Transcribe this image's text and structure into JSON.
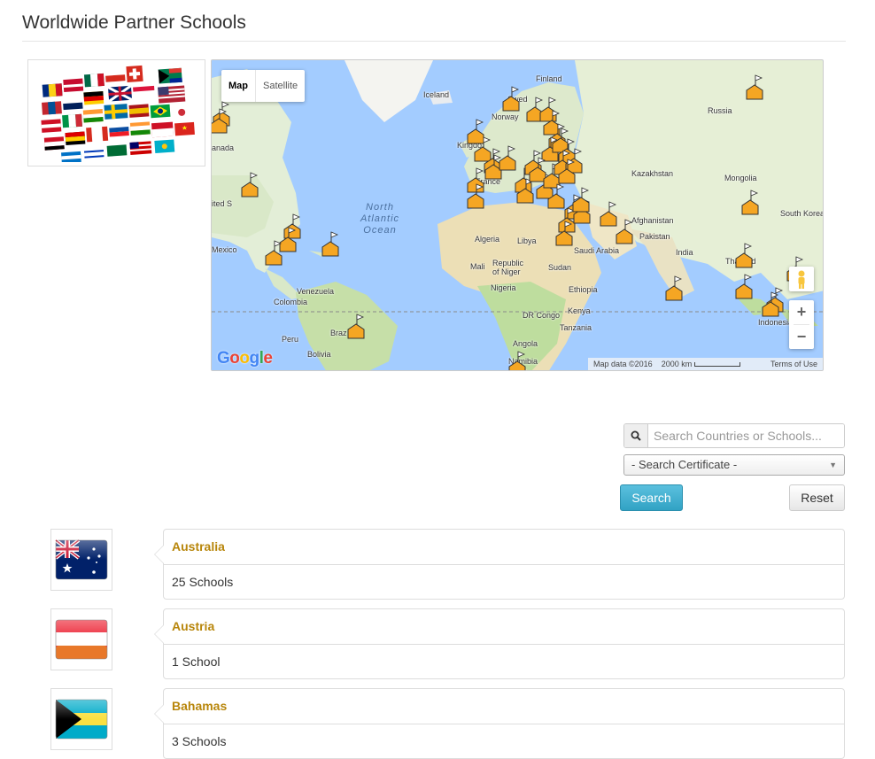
{
  "page": {
    "title": "Worldwide Partner Schools"
  },
  "map": {
    "type_control": {
      "map": "Map",
      "satellite": "Satellite"
    },
    "labels": {
      "iceland": "Iceland",
      "finland": "Finland",
      "sweden": "Swed",
      "norway": "Norway",
      "russia": "Russia",
      "kingdom": "Kingdo",
      "france": "France",
      "kazakhstan": "Kazakhstan",
      "mongolia": "Mongolia",
      "canada": "anada",
      "united_states": "ited S",
      "afghanistan": "Afghanistan",
      "south_korea": "South Korea",
      "mexico": "Mexico",
      "algeria": "Algeria",
      "libya": "Libya",
      "saudi_arabia": "Saudi Arabia",
      "pakistan": "Pakistan",
      "india": "India",
      "thailand": "Thailand",
      "mali": "Mali",
      "republic_of_niger": "Republic of Niger",
      "sudan": "Sudan",
      "venezuela": "Venezuela",
      "colombia": "Colombia",
      "nigeria": "Nigeria",
      "ethiopia": "Ethiopia",
      "dr_congo": "DR Congo",
      "kenya": "Kenya",
      "peru": "Peru",
      "brazil": "Braz",
      "tanzania": "Tanzania",
      "indonesia": "Indonesia",
      "angola": "Angola",
      "bolivia": "Bolivia",
      "namibia": "Namibia"
    },
    "ocean": {
      "line1": "North",
      "line2": "Atlantic",
      "line3": "Ocean"
    },
    "footer": {
      "data": "Map data ©2016",
      "scale": "2000 km",
      "terms": "Terms of Use"
    },
    "logo": "Google",
    "zoom": {
      "in": "+",
      "out": "−"
    }
  },
  "search": {
    "placeholder": "Search Countries or Schools...",
    "certificate_selected": "- Search Certificate -",
    "search_label": "Search",
    "reset_label": "Reset"
  },
  "countries": [
    {
      "name": "Australia",
      "count": "25 Schools"
    },
    {
      "name": "Austria",
      "count": "1 School"
    },
    {
      "name": "Bahamas",
      "count": "3 Schools"
    }
  ],
  "colors": {
    "accent": "#b8860b",
    "primary_button": "#5bc0de",
    "marker": "#f5a623"
  }
}
